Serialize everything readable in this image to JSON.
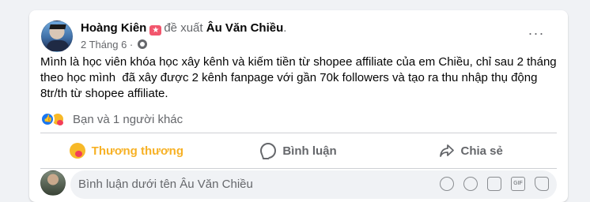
{
  "post": {
    "author": "Hoàng Kiên",
    "verb": "đề xuất",
    "target": "Âu Văn Chiều",
    "target_suffix": ".",
    "date": "2 Tháng 6 ·",
    "more_label": "···",
    "text": "Mình là học viên khóa học xây kênh và kiếm tiền từ shopee affiliate của em Chiều, chỉ sau 2 tháng\ntheo học mình  đã xây được 2 kênh fanpage với gần 70k followers và tạo ra thu nhập thụ động\n8tr/th từ shopee affiliate."
  },
  "reactions": {
    "summary": "Bạn và 1 người khác"
  },
  "actions": {
    "react_label": "Thương thương",
    "comment_label": "Bình luận",
    "share_label": "Chia sẻ"
  },
  "comment_box": {
    "placeholder": "Bình luận dưới tên Âu Văn Chiều",
    "gif_label": "GIF"
  },
  "colors": {
    "care": "#f7b125",
    "muted": "#65676b",
    "like": "#1877f2"
  }
}
